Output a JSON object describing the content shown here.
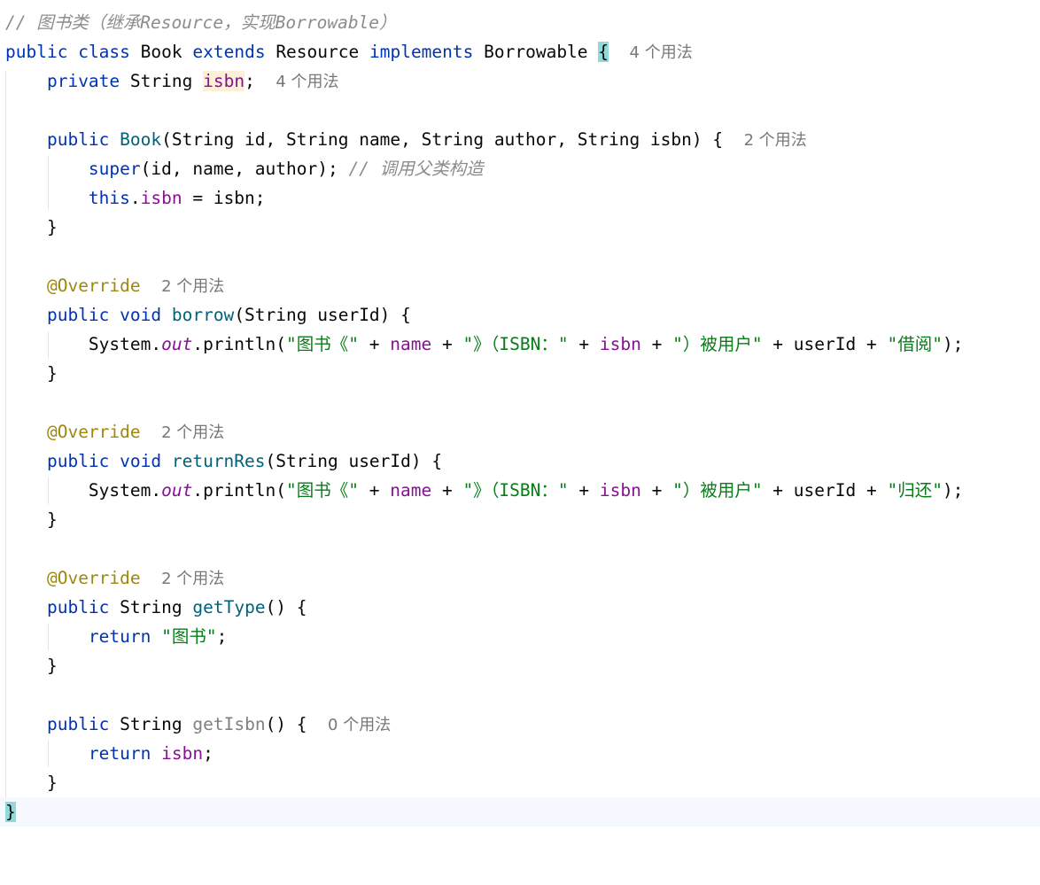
{
  "editor": {
    "file_comment": "// 图书类（继承Resource，实现Borrowable）",
    "class_decl": {
      "public": "public",
      "class": "class",
      "name": "Book",
      "extends": "extends",
      "parent": "Resource",
      "implements": "implements",
      "iface": "Borrowable",
      "open_brace": "{",
      "hint": "4 个用法"
    },
    "field": {
      "modifier": "private",
      "type": "String",
      "name": "isbn",
      "end": ";",
      "hint": "4 个用法"
    },
    "constructor": {
      "modifier": "public",
      "name": "Book",
      "params": "(String id, String name, String author, String isbn) {",
      "hint": "2 个用法",
      "super_kw": "super",
      "super_args": "(id, name, author);",
      "super_comment": "// 调用父类构造",
      "this_kw": "this",
      "dot": ".",
      "field": "isbn",
      "assign_rest": " = isbn;",
      "close": "}"
    },
    "borrow": {
      "annotation": "@Override",
      "hint": "2 个用法",
      "sig_kw": "public void",
      "name": "borrow",
      "params": "(String userId) {",
      "sys": "System.",
      "out": "out",
      "println": ".println(",
      "s1": "\"图书《\"",
      "p1": " + ",
      "name_field": "name",
      "p2": " + ",
      "s2": "\"》（ISBN：\"",
      "p3": " + ",
      "isbn_field": "isbn",
      "p4": " + ",
      "s3": "\"）被用户\"",
      "p5": " + userId + ",
      "s4": "\"借阅\"",
      "end": ");",
      "close": "}"
    },
    "returnRes": {
      "annotation": "@Override",
      "hint": "2 个用法",
      "sig_kw": "public void",
      "name": "returnRes",
      "params": "(String userId) {",
      "sys": "System.",
      "out": "out",
      "println": ".println(",
      "s1": "\"图书《\"",
      "p1": " + ",
      "name_field": "name",
      "p2": " + ",
      "s2": "\"》（ISBN：\"",
      "p3": " + ",
      "isbn_field": "isbn",
      "p4": " + ",
      "s3": "\"）被用户\"",
      "p5": " + userId + ",
      "s4": "\"归还\"",
      "end": ");",
      "close": "}"
    },
    "getType": {
      "annotation": "@Override",
      "hint": "2 个用法",
      "modifier": "public",
      "type": "String",
      "name": "getType",
      "params": "() {",
      "return_kw": "return",
      "value": "\"图书\"",
      "end": ";",
      "close": "}"
    },
    "getIsbn": {
      "modifier": "public",
      "type": "String",
      "name": "getIsbn",
      "params": "() {",
      "hint": "0 个用法",
      "return_kw": "return",
      "field": "isbn",
      "end": ";",
      "close": "}"
    },
    "class_close": "}"
  }
}
